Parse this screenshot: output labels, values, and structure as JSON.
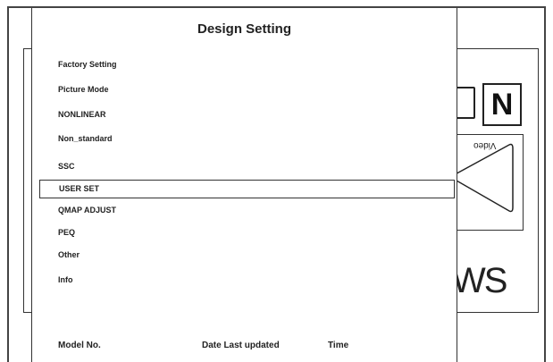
{
  "panel": {
    "title": "Design Setting"
  },
  "menu": {
    "items": [
      {
        "label": "Factory Setting"
      },
      {
        "label": "Picture Mode"
      },
      {
        "label": "NONLINEAR"
      },
      {
        "label": "Non_standard"
      },
      {
        "label": "SSC"
      },
      {
        "label": "USER SET"
      },
      {
        "label": "QMAP ADJUST"
      },
      {
        "label": "PEQ"
      },
      {
        "label": "Other"
      },
      {
        "label": "Info"
      }
    ],
    "selected": "USER SET"
  },
  "footer": {
    "model_label": "Model No.",
    "date_label": "Date Last updated",
    "time_label": "Time"
  },
  "background": {
    "n_label": "N",
    "video_label": "Video",
    "logo_text": "WS"
  }
}
